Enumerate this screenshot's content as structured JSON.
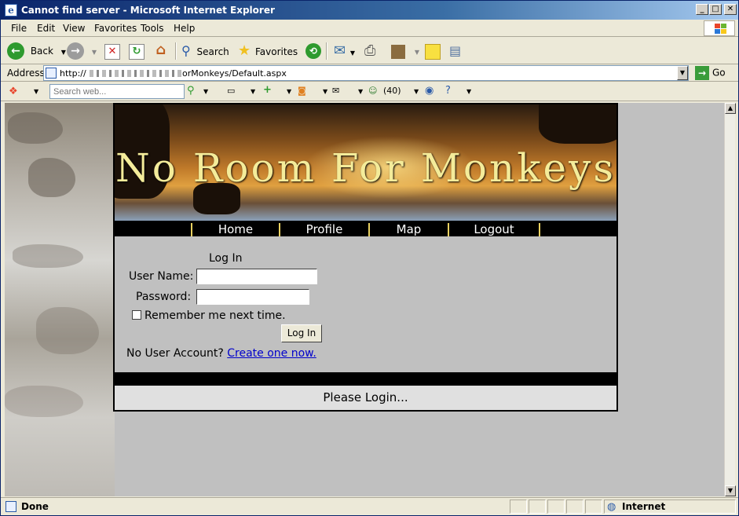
{
  "window": {
    "title": "Cannot find server - Microsoft Internet Explorer",
    "minimize": "_",
    "maximize": "□",
    "close": "✕"
  },
  "menu": [
    "File",
    "Edit",
    "View",
    "Favorites",
    "Tools",
    "Help"
  ],
  "toolbar": {
    "back": "Back",
    "search": "Search",
    "favorites": "Favorites"
  },
  "address": {
    "label": "Address",
    "url": "http://                   /NoRoomForMonkeys/Default.aspx",
    "go": "Go"
  },
  "searchbar": {
    "placeholder": "Search web...",
    "count": "(40)"
  },
  "site": {
    "title": "No Room For Monkeys",
    "nav": [
      "Home",
      "Profile",
      "Map",
      "Logout"
    ],
    "login": {
      "title": "Log In",
      "username_label": "User Name:",
      "password_label": "Password:",
      "remember_label": "Remember me next time.",
      "button": "Log In",
      "no_account": "No User Account?",
      "create_link": "Create one now."
    },
    "status": "Please Login..."
  },
  "statusbar": {
    "left": "Done",
    "zone": "Internet"
  },
  "colors": {
    "titlebar": "#0a246a",
    "banner_text": "#f4ec9a",
    "nav_divider": "#e8d060",
    "link": "#0000cc"
  }
}
